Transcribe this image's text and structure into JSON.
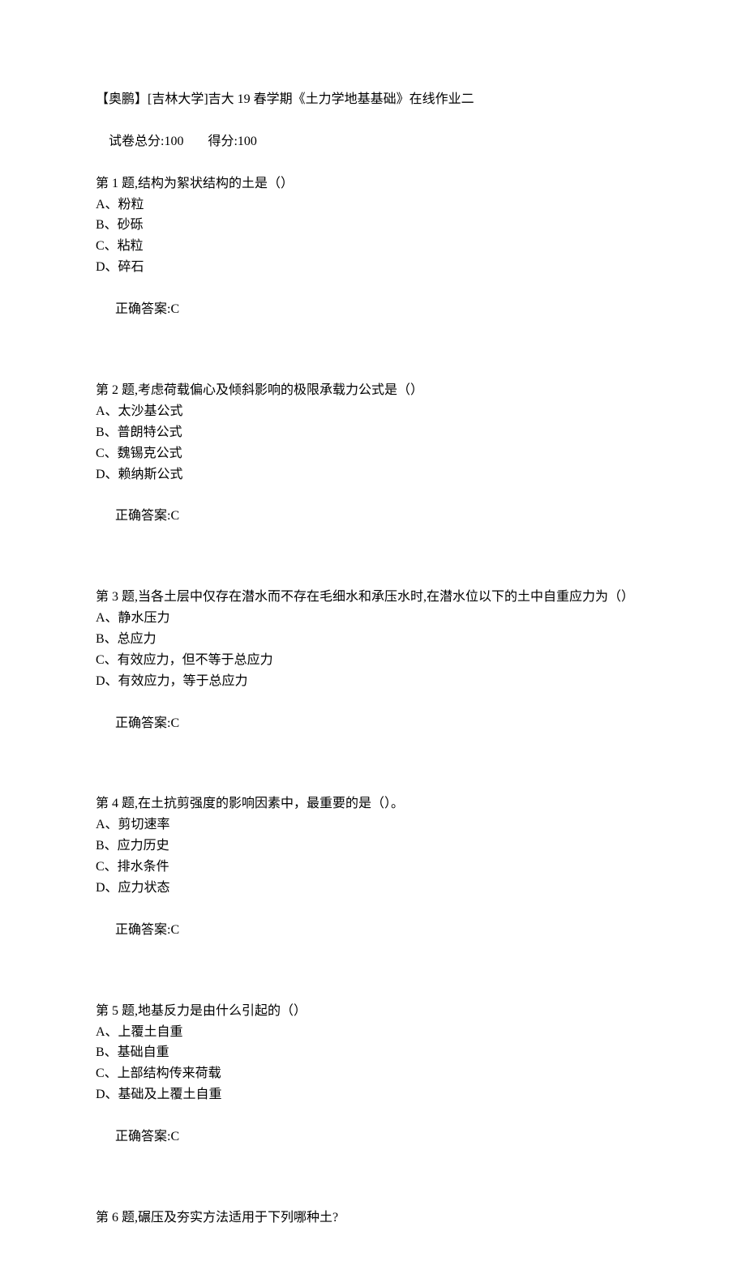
{
  "header": {
    "title": "【奥鹏】[吉林大学]吉大 19 春学期《土力学地基基础》在线作业二",
    "total_label": "试卷总分:100",
    "score_label": "得分:100"
  },
  "answer_label_prefix": "正确答案:",
  "questions": [
    {
      "heading": "第 1 题,结构为絮状结构的土是（）",
      "options": [
        "A、粉粒",
        "B、砂砾",
        "C、粘粒",
        "D、碎石"
      ],
      "answer": "C"
    },
    {
      "heading": "第 2 题,考虑荷载偏心及倾斜影响的极限承载力公式是（）",
      "options": [
        "A、太沙基公式",
        "B、普朗特公式",
        "C、魏锡克公式",
        "D、赖纳斯公式"
      ],
      "answer": "C"
    },
    {
      "heading": "第 3 题,当各土层中仅存在潜水而不存在毛细水和承压水时,在潜水位以下的土中自重应力为（）",
      "options": [
        "A、静水压力",
        "B、总应力",
        "C、有效应力，但不等于总应力",
        "D、有效应力，等于总应力"
      ],
      "answer": "C"
    },
    {
      "heading": "第 4 题,在土抗剪强度的影响因素中，最重要的是（）。",
      "options": [
        "A、剪切速率",
        "B、应力历史",
        "C、排水条件",
        "D、应力状态"
      ],
      "answer": "C"
    },
    {
      "heading": "第 5 题,地基反力是由什么引起的（）",
      "options": [
        "A、上覆土自重",
        "B、基础自重",
        "C、上部结构传来荷载",
        "D、基础及上覆土自重"
      ],
      "answer": "C"
    },
    {
      "heading": "第 6 题,碾压及夯实方法适用于下列哪种土?",
      "options": [],
      "answer": null
    }
  ]
}
